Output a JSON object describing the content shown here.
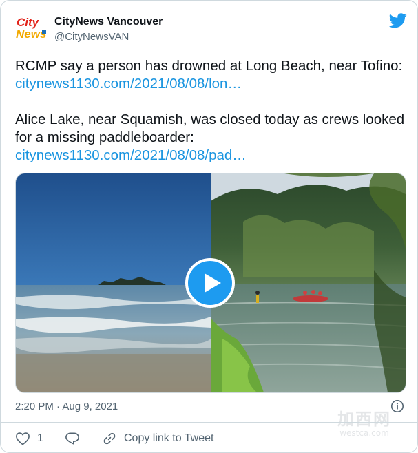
{
  "account": {
    "display_name": "CityNews Vancouver",
    "handle": "@CityNewsVAN",
    "avatar_logo_text": "CityNews"
  },
  "tweet": {
    "para1_text": "RCMP say a person has drowned at Long Beach, near Tofino: ",
    "para1_link": "citynews1130.com/2021/08/08/lon…",
    "para2_text": "Alice Lake, near Squamish, was closed today as crews looked for a missing paddleboarder:",
    "para2_link": "citynews1130.com/2021/08/08/pad…"
  },
  "media": {
    "type": "video",
    "play_icon": "play-icon"
  },
  "footer": {
    "timestamp": "2:20 PM · Aug 9, 2021",
    "like_count": "1",
    "copy_link_label": "Copy link to Tweet"
  },
  "watermark": {
    "cn": "加西网",
    "url": "westca.com"
  },
  "colors": {
    "link": "#1b95e0",
    "brand_blue": "#1d9bf0",
    "text": "#0f1419",
    "muted": "#536471",
    "border": "#cfd9de"
  },
  "icons": [
    "twitter-bird-icon",
    "info-icon",
    "heart-icon",
    "reply-icon",
    "link-icon",
    "play-icon"
  ]
}
